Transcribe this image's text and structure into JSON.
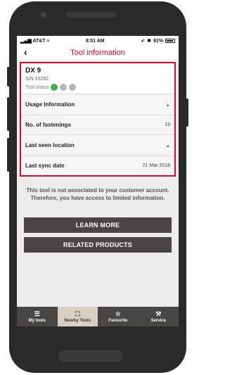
{
  "status_bar": {
    "carrier": "AT&T",
    "time": "8:51 AM",
    "battery": "91%"
  },
  "nav": {
    "back_icon": "chevron-left-icon",
    "title": "Tool information"
  },
  "tool": {
    "name": "DX 9",
    "serial": "S/N:10282",
    "status_label": "Tool status",
    "status_dots": [
      "#3bb34a",
      "#b5b5b5",
      "#b5b5b5"
    ]
  },
  "rows": {
    "usage": "Usage Information",
    "fastenings_label": "No. of fastenings",
    "fastenings_value": "19",
    "last_seen": "Last seen location",
    "sync_label": "Last sync date",
    "sync_value": "21 Mar 2018"
  },
  "notice": "This tool is not associated to your customer account. Therefore, you have access to limited information.",
  "buttons": {
    "learn_more": "LEARN MORE",
    "related_products": "RELATED PRODUCTS"
  },
  "tabs": [
    {
      "label": "My tools",
      "icon": "list-icon",
      "active": false
    },
    {
      "label": "Nearby Tools",
      "icon": "scan-frame-icon",
      "active": true
    },
    {
      "label": "Favourite",
      "icon": "star-icon",
      "active": false
    },
    {
      "label": "Service",
      "icon": "wrench-icon",
      "active": false
    }
  ],
  "colors": {
    "accent": "#c8102e",
    "tabbar": "#4a4545",
    "button": "#4a4444"
  }
}
